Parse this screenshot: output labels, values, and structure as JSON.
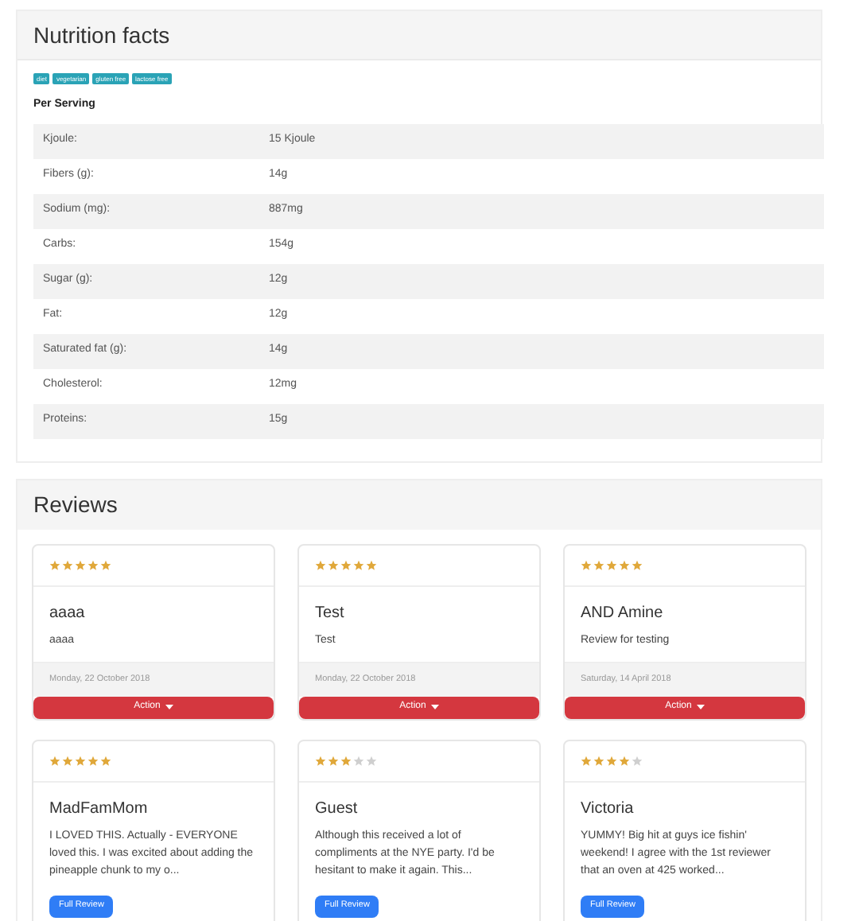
{
  "nutrition": {
    "title": "Nutrition facts",
    "tags": [
      "diet",
      "vegetarian",
      "gluten free",
      "lactose free"
    ],
    "subtitle": "Per Serving",
    "rows": [
      {
        "label": "Kjoule:",
        "value": "15 Kjoule"
      },
      {
        "label": "Fibers (g):",
        "value": "14g"
      },
      {
        "label": "Sodium (mg):",
        "value": "887mg"
      },
      {
        "label": "Carbs:",
        "value": "154g"
      },
      {
        "label": "Sugar (g):",
        "value": "12g"
      },
      {
        "label": "Fat:",
        "value": "12g"
      },
      {
        "label": "Saturated fat (g):",
        "value": "14g"
      },
      {
        "label": "Cholesterol:",
        "value": "12mg"
      },
      {
        "label": "Proteins:",
        "value": "15g"
      }
    ]
  },
  "reviews": {
    "title": "Reviews",
    "items": [
      {
        "kind": "action",
        "stars": 5,
        "author": "aaaa",
        "text": "aaaa",
        "date": "Monday, 22 October 2018",
        "button": "Action"
      },
      {
        "kind": "action",
        "stars": 5,
        "author": "Test",
        "text": "Test",
        "date": "Monday, 22 October 2018",
        "button": "Action"
      },
      {
        "kind": "action",
        "stars": 5,
        "author": "AND Amine",
        "text": "Review for testing",
        "date": "Saturday, 14 April 2018",
        "button": "Action"
      },
      {
        "kind": "summary",
        "stars": 5,
        "author": "MadFamMom",
        "text": "I LOVED THIS. Actually - EVERYONE loved this. I was excited about adding the pineapple chunk to my o...",
        "button": "Full Review"
      },
      {
        "kind": "summary",
        "stars": 3,
        "author": "Guest",
        "text": "Although this received a lot of compliments at the NYE party. I'd be hesitant to make it again. This...",
        "button": "Full Review"
      },
      {
        "kind": "summary",
        "stars": 4,
        "author": "Victoria",
        "text": "YUMMY! Big hit at guys ice fishin' weekend! I agree with the 1st reviewer that an oven at 425 worked...",
        "button": "Full Review"
      }
    ]
  }
}
